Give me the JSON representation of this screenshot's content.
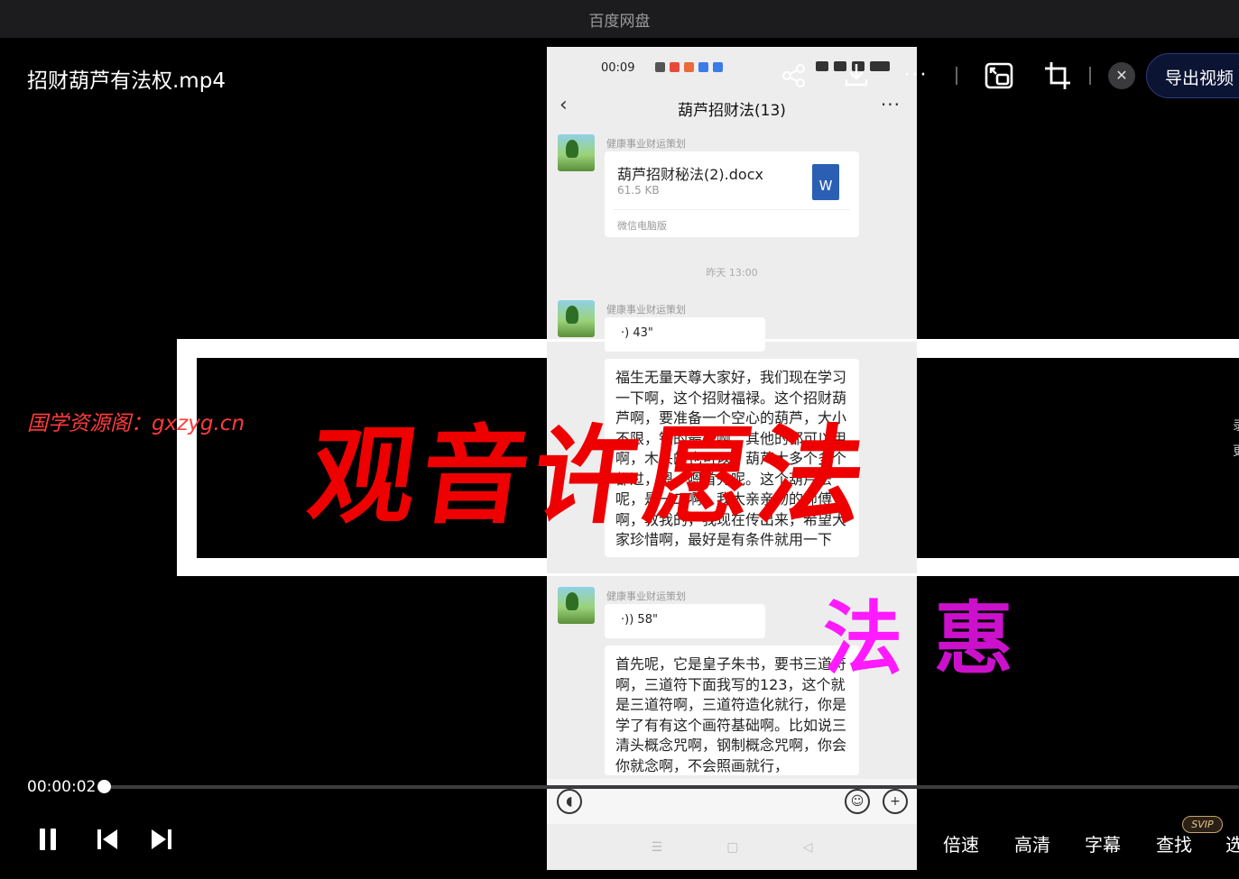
{
  "window": {
    "title": "百度网盘"
  },
  "video": {
    "file_title": "招财葫芦有法权.mp4"
  },
  "phone": {
    "status_time": "00:09",
    "chat_title": "葫芦招财法(13)",
    "sender_name": "健康事业财运策划",
    "file": {
      "name": "葫芦招财秘法(2).docx",
      "size": "61.5 KB",
      "source": "微信电脑版",
      "icon_letter": "W"
    },
    "time_divider": "昨天 13:00",
    "voice1": "43\"",
    "transcript1": "福生无量天尊大家好，我们现在学习一下啊，这个招财福禄。这个招财葫芦啊，要准备一个空心的葫芦，大小不限，铜的最好啊，其他的都可以用啊，木头的也可以，葫芦大多个多个都过，嗯，嗯首先呢。这个葫芦法呢，是一二啊，我太亲亲吻的师傅啊，教我的，我现在传出来，希望大家珍惜啊，最好是有条件就用一下",
    "voice2": "58\"",
    "transcript2": "首先呢，它是皇子朱书，要书三道符啊，三道符下面我写的123，这个就是三道符啊，三道符造化就行，你是学了有有这个画符基础啊。比如说三清头概念咒啊，钢制概念咒啊，你会你就念啊，不会照画就行，"
  },
  "overlay": {
    "main_text": "观音许愿法",
    "sub_char_1": "法",
    "sub_char_2": "惠",
    "watermark": "国学资源阁：gxzyg.cn",
    "side_glyph_1": "录",
    "side_glyph_2": "更"
  },
  "toolbar": {
    "export_label": "导出视频",
    "close_symbol": "✕"
  },
  "playback": {
    "timecode": "00:00:02",
    "progress": 0.001,
    "speed_label": "倍速",
    "quality_label": "高清",
    "subtitle_label": "字幕",
    "find_label": "查找",
    "find_badge": "SVIP",
    "more_label": "选"
  },
  "colors": {
    "overlay_red": "#ee0000",
    "overlay_magenta": "#ff1aff",
    "export_bg": "#0c1434"
  }
}
